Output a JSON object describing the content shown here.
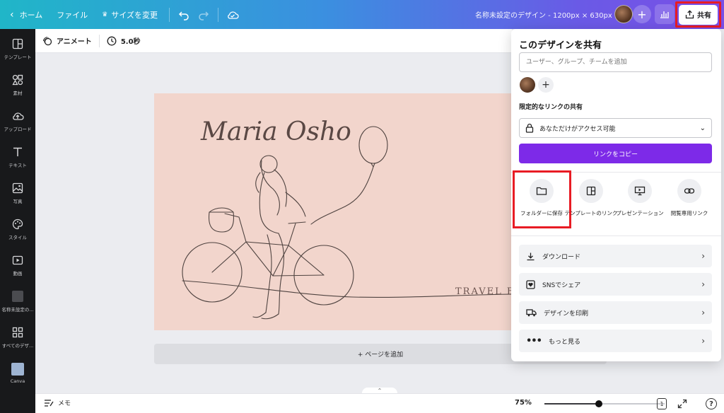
{
  "topbar": {
    "home_label": "ホーム",
    "file_label": "ファイル",
    "resize_label": "サイズを変更",
    "doc_title": "名称未設定のデザイン - 1200px × 630px",
    "share_label": "共有"
  },
  "sidebar": {
    "items": [
      {
        "label": "テンプレート",
        "icon": "template-icon"
      },
      {
        "label": "素材",
        "icon": "elements-icon"
      },
      {
        "label": "アップロード",
        "icon": "upload-icon"
      },
      {
        "label": "テキスト",
        "icon": "text-icon"
      },
      {
        "label": "写真",
        "icon": "photo-icon"
      },
      {
        "label": "スタイル",
        "icon": "palette-icon"
      },
      {
        "label": "動画",
        "icon": "video-icon"
      },
      {
        "label": "名称未設定の...",
        "icon": "design-thumb-icon"
      },
      {
        "label": "すべてのデザ...",
        "icon": "grid-icon"
      },
      {
        "label": "Canva",
        "icon": "canva-icon"
      }
    ]
  },
  "subbar": {
    "animate_label": "アニメート",
    "duration_label": "5.0秒"
  },
  "canvas": {
    "script_name": "Maria Osho",
    "travel_text": "TRAVEL B",
    "add_page_label": "+ ページを追加"
  },
  "bottombar": {
    "memo_label": "メモ",
    "zoom_label": "75%",
    "zoom_fraction": 0.45,
    "page_count": "1"
  },
  "share_panel": {
    "title": "このデザインを共有",
    "people_placeholder": "ユーザー、グループ、チームを追加",
    "link_heading": "限定的なリンクの共有",
    "access_value": "あなただけがアクセス可能",
    "copy_label": "リンクをコピー",
    "options": [
      {
        "label": "フォルダーに保存",
        "icon": "folder-icon"
      },
      {
        "label": "テンプレートのリンク",
        "icon": "template-link-icon"
      },
      {
        "label": "プレゼンテーション",
        "icon": "presentation-icon"
      },
      {
        "label": "閲覧専用リンク",
        "icon": "link-icon"
      }
    ],
    "rows": [
      {
        "label": "ダウンロード",
        "icon": "download-icon"
      },
      {
        "label": "SNSでシェア",
        "icon": "heart-icon"
      },
      {
        "label": "デザインを印刷",
        "icon": "truck-icon"
      },
      {
        "label": "もっと見る",
        "icon": "more-icon"
      }
    ]
  },
  "colors": {
    "accent": "#7d2ae8",
    "highlight": "#e81c24",
    "canvas_bg": "#f2d5cc",
    "sidebar_bg": "#18191b"
  }
}
